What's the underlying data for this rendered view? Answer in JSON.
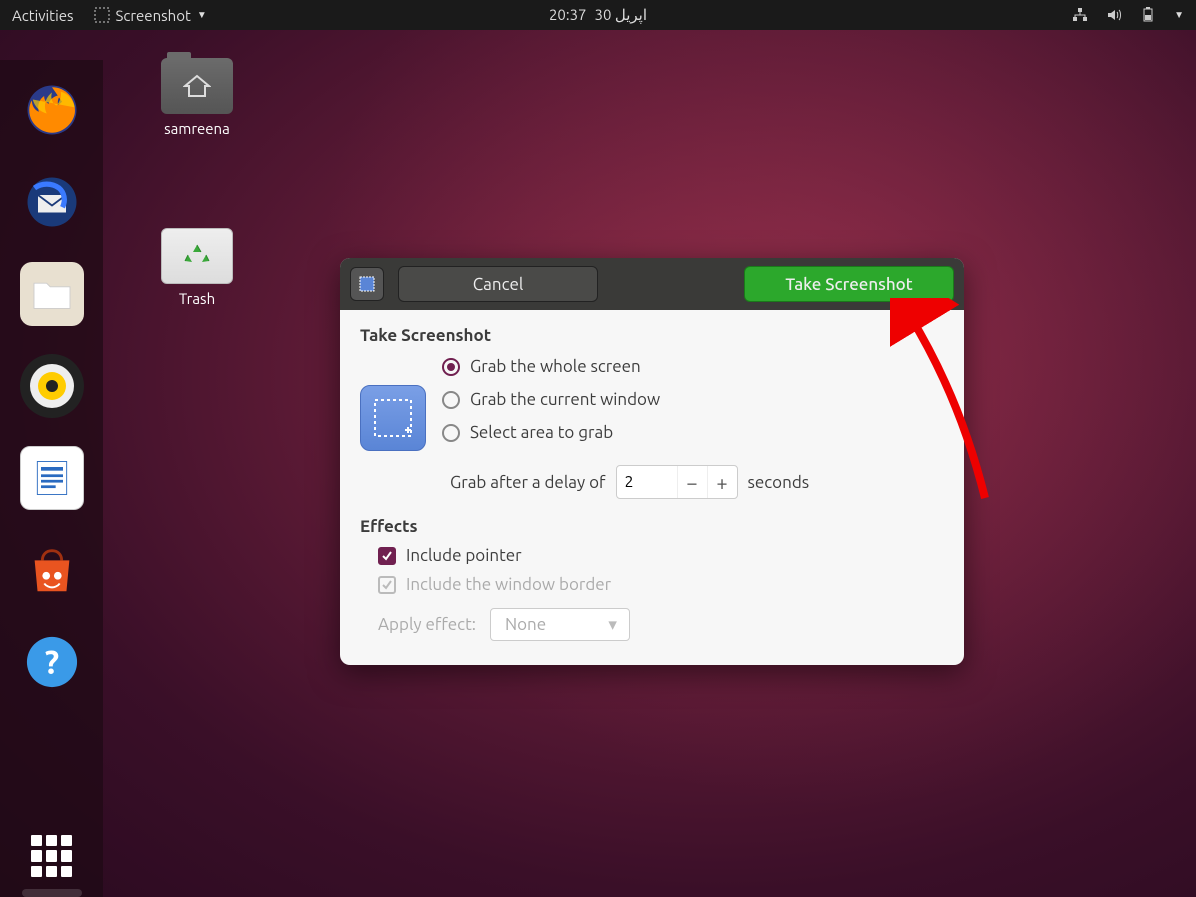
{
  "topbar": {
    "activities": "Activities",
    "app_name": "Screenshot",
    "clock": "20:37",
    "date": "اپریل 30"
  },
  "desktop": {
    "home_folder": "samreena",
    "trash": "Trash"
  },
  "dialog": {
    "cancel": "Cancel",
    "take": "Take Screenshot",
    "section_take": "Take Screenshot",
    "radio_whole": "Grab the whole screen",
    "radio_window": "Grab the current window",
    "radio_area": "Select area to grab",
    "delay_prefix": "Grab after a delay of",
    "delay_value": "2",
    "delay_suffix": "seconds",
    "section_effects": "Effects",
    "check_pointer": "Include pointer",
    "check_border": "Include the window border",
    "apply_effect_label": "Apply effect:",
    "apply_effect_value": "None"
  }
}
